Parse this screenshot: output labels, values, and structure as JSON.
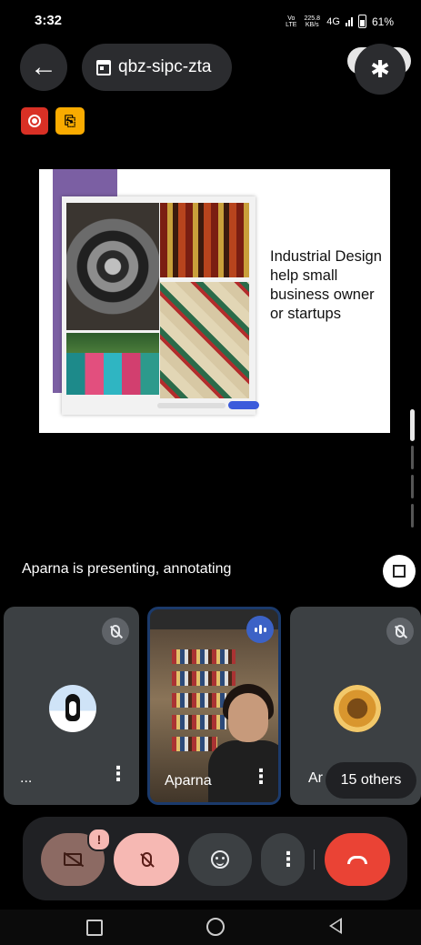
{
  "status_bar": {
    "time": "3:32",
    "volte": "Vo LTE",
    "speed": "225.8 KB/s",
    "network": "4G",
    "battery": "61%"
  },
  "top_bar": {
    "back_icon": "arrow-left-icon",
    "meeting_code": "qbz-sipc-zta",
    "bluetooth_icon": "bluetooth-icon"
  },
  "badges": {
    "recording_icon": "record-icon",
    "captions_icon": "captions-off-icon",
    "captions_glyph": "⎘"
  },
  "slide": {
    "text": "Industrial Design help small business owner or startups"
  },
  "presenting": {
    "text": "Aparna is presenting, annotating"
  },
  "tiles": [
    {
      "name": "...",
      "muted": true,
      "avatar": "penguin-avatar"
    },
    {
      "name": "Aparna",
      "speaking": true
    },
    {
      "name": "Ar",
      "muted": true,
      "avatar": "emblem-avatar"
    }
  ],
  "others": {
    "label": "15 others"
  },
  "controls": {
    "camera": "camera-off",
    "alert": "!",
    "mic": "mic-off",
    "reactions": "emoji",
    "more": "more-options",
    "end": "end-call"
  },
  "colors": {
    "end_call": "#ea4335",
    "mic_off_bg": "#f6b8b3",
    "record": "#d93025",
    "caption_badge": "#f9ab00",
    "speaking": "#3c62c6"
  }
}
